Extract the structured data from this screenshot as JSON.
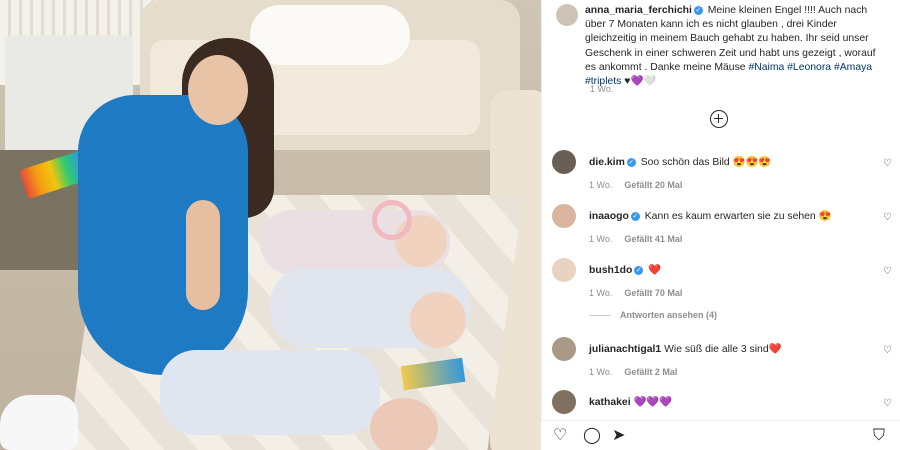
{
  "post": {
    "username": "anna_maria_ferchichi",
    "caption_text": "Meine kleinen Engel !!!! Auch nach über 7 Monaten kann ich es nicht glauben , drei Kinder gleichzeitig in meinem Bauch gehabt zu haben. Ihr seid unser Geschenk in einer schweren Zeit und habt uns gezeigt , worauf es ankommt . Danke meine Mäuse",
    "hashtags": [
      "#Naima",
      "#Leonora",
      "#Amaya",
      "#triplets"
    ],
    "caption_emojis": "♥💜🤍",
    "time": "1 Wo."
  },
  "comments": [
    {
      "username": "die.kim",
      "verified": "true",
      "text": "Soo schön das Bild 😍😍😍",
      "time": "1 Wo.",
      "likes": "Gefällt 20 Mal"
    },
    {
      "username": "inaaogo",
      "verified": "true",
      "text": "Kann es kaum erwarten sie zu sehen 😍",
      "time": "1 Wo.",
      "likes": "Gefällt 41 Mal"
    },
    {
      "username": "bush1do",
      "verified": "true",
      "text": "❤️",
      "time": "1 Wo.",
      "likes": "Gefällt 70 Mal",
      "replies_label": "Antworten ansehen (4)"
    },
    {
      "username": "julianachtigal1",
      "verified": "false",
      "text": "Wie süß die alle 3 sind❤️",
      "time": "1 Wo.",
      "likes": "Gefällt 2 Mal"
    },
    {
      "username": "kathakei",
      "verified": "false",
      "text": "💜💜💜"
    }
  ],
  "icons": {
    "heart": "♡",
    "verified": "✓",
    "like_action": "♡",
    "comment_action": "◯",
    "share_action": "➤",
    "save_action": "⛉"
  },
  "colors": {
    "hashtag": "#00376b",
    "verified": "#3897f0",
    "meta": "#8e8e8e"
  }
}
